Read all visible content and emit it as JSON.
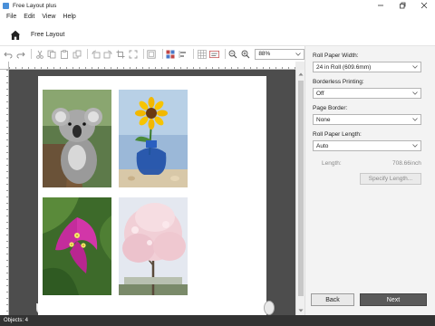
{
  "window": {
    "title": "Free Layout plus",
    "controls": [
      "minimize-icon",
      "maximize-icon",
      "close-icon"
    ]
  },
  "menu": {
    "items": [
      "File",
      "Edit",
      "View",
      "Help"
    ]
  },
  "nav": {
    "home_icon": "home-icon",
    "title": "Free Layout"
  },
  "toolbar": {
    "zoom_value": "88%"
  },
  "layout": {
    "photos": [
      {
        "subject": "koala"
      },
      {
        "subject": "sunflower-in-vase"
      },
      {
        "subject": "bougainvillea-flower"
      },
      {
        "subject": "cherry-blossom-tree"
      }
    ]
  },
  "settings": {
    "roll_paper_width": {
      "label": "Roll Paper Width:",
      "value": "24 in Roll (609.6mm)"
    },
    "borderless_printing": {
      "label": "Borderless Printing:",
      "value": "Off"
    },
    "page_border": {
      "label": "Page Border:",
      "value": "None"
    },
    "roll_paper_length": {
      "label": "Roll Paper Length:",
      "value": "Auto"
    },
    "length": {
      "label": "Length:",
      "value": "708.66",
      "unit": "inch"
    },
    "specify_length_button": "Specify Length..."
  },
  "footer": {
    "back_button": "Back",
    "next_button": "Next"
  },
  "status": {
    "objects_text": "Objects: 4"
  },
  "colors": {
    "canvas_bg": "#4d4d4d",
    "next_button_bg": "#5a5a5a",
    "panel_bg": "#f3f3f3"
  }
}
